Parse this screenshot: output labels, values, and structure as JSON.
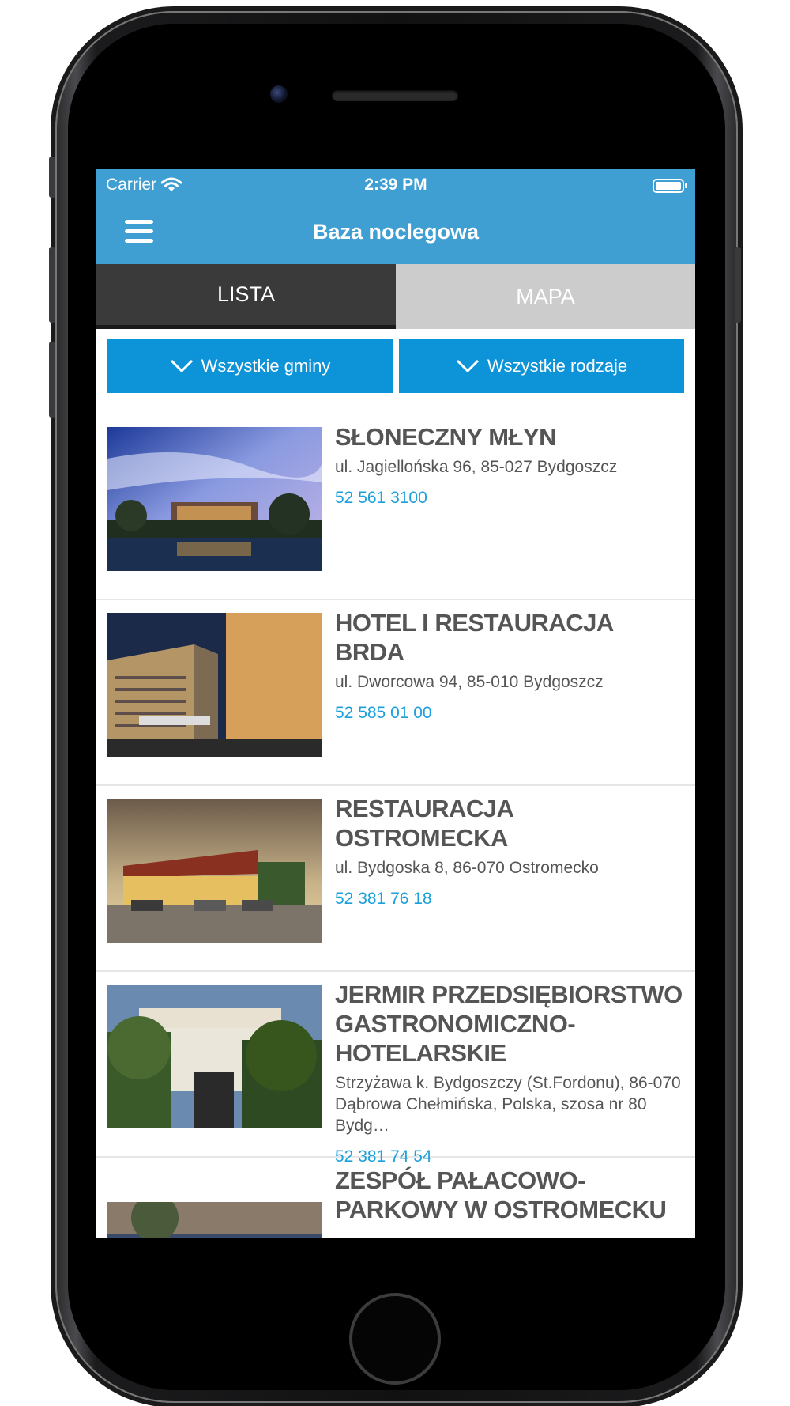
{
  "status": {
    "carrier": "Carrier",
    "time": "2:39 PM"
  },
  "nav": {
    "title": "Baza noclegowa"
  },
  "tabs": [
    {
      "label": "LISTA"
    },
    {
      "label": "MAPA"
    }
  ],
  "filters": {
    "municipality": "Wszystkie gminy",
    "type": "Wszystkie rodzaje"
  },
  "items": [
    {
      "name": "SŁONECZNY MŁYN",
      "address": "ul. Jagiellońska 96, 85-027 Bydgoszcz",
      "phone": "52 561 3100"
    },
    {
      "name": "HOTEL I RESTAURACJA BRDA",
      "address": "ul. Dworcowa 94, 85-010 Bydgoszcz",
      "phone": "52 585 01 00"
    },
    {
      "name": "RESTAURACJA OSTROMECKA",
      "address": "ul. Bydgoska 8, 86-070 Ostromecko",
      "phone": "52 381 76 18"
    },
    {
      "name": "JERMIR PRZEDSIĘBIORSTWO GASTRONOMICZNO-HOTELARSKIE",
      "address": "Strzyżawa k. Bydgoszczy (St.Fordonu), 86-070 Dąbrowa Chełmińska, Polska, szosa nr 80 Bydg…",
      "phone": "52 381 74 54"
    },
    {
      "name": "ZESPÓŁ PAŁACOWO-PARKOWY W OSTROMECKU",
      "address": "",
      "phone": ""
    }
  ],
  "colors": {
    "header": "#3f9fd2",
    "filter": "#0d93d8",
    "tab_active": "#3a3a3a",
    "tab_inactive": "#cccccc",
    "phone_link": "#1ba0dc"
  },
  "icons": [
    "wifi-icon",
    "battery-icon",
    "hamburger-menu-icon",
    "chevron-down-icon"
  ]
}
